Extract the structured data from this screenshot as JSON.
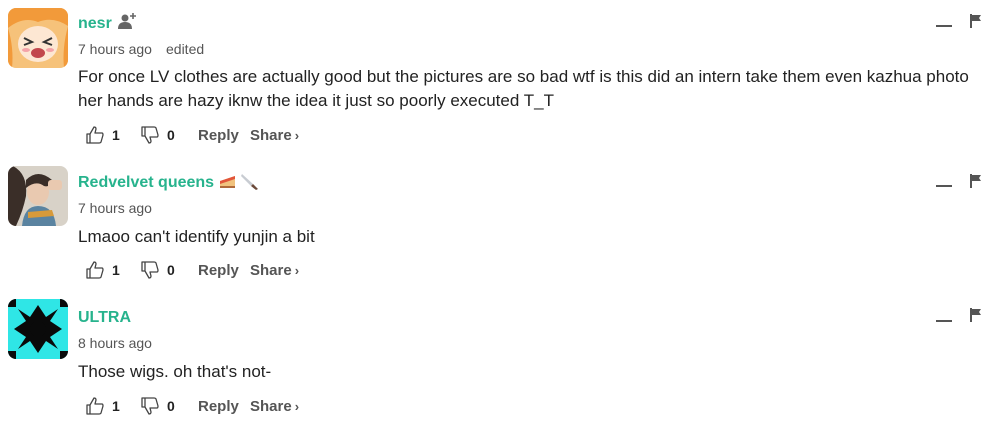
{
  "comments": [
    {
      "author": "nesr",
      "time": "7 hours ago",
      "edited": "edited",
      "text": "For once LV clothes are actually good but the pictures are so bad wtf is this did an intern take them even kazhua photo her hands are hazy iknw the idea it just so poorly executed T_T",
      "likes": "1",
      "dislikes": "0",
      "reply": "Reply",
      "share": "Share",
      "avatar_icon": "anime-avatar",
      "badge_icon": "follow-user-icon"
    },
    {
      "author": "Redvelvet queens",
      "time": "7 hours ago",
      "text": "Lmaoo can't identify yunjin a bit",
      "likes": "1",
      "dislikes": "0",
      "reply": "Reply",
      "share": "Share",
      "avatar_icon": "photo-avatar",
      "badge_icons": [
        "cake-emoji",
        "knife-emoji"
      ]
    },
    {
      "author": "ULTRA",
      "time": "8 hours ago",
      "text": "Those wigs. oh that's not-",
      "likes": "1",
      "dislikes": "0",
      "reply": "Reply",
      "share": "Share",
      "avatar_icon": "cyan-pattern-avatar"
    }
  ],
  "share_chevron": "›",
  "colors": {
    "author": "#27b38d",
    "text": "#222222",
    "meta": "#555555"
  }
}
